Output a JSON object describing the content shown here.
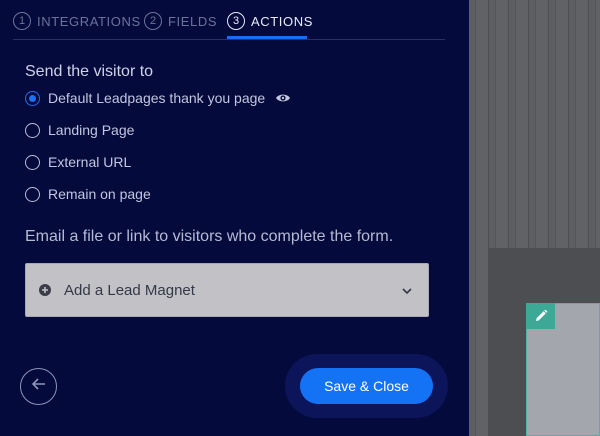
{
  "tabs": [
    {
      "num": "1",
      "label": "INTEGRATIONS"
    },
    {
      "num": "2",
      "label": "FIELDS"
    },
    {
      "num": "3",
      "label": "ACTIONS"
    }
  ],
  "active_tab": "ACTIONS",
  "send_heading": "Send the visitor to",
  "options": [
    {
      "label": "Default Leadpages thank you page",
      "checked": true
    },
    {
      "label": "Landing Page",
      "checked": false
    },
    {
      "label": "External URL",
      "checked": false
    },
    {
      "label": "Remain on page",
      "checked": false
    }
  ],
  "email_text": "Email a file or link to visitors who complete the form.",
  "lead_magnet_label": "Add a Lead Magnet",
  "save_label": "Save & Close",
  "colors": {
    "background": "#050a3d",
    "accent": "#1473f5",
    "editor_accent": "#3ea897"
  },
  "icons": [
    "eye-icon",
    "plus-circle-icon",
    "chevron-down-icon",
    "arrow-left-icon",
    "pencil-icon"
  ]
}
